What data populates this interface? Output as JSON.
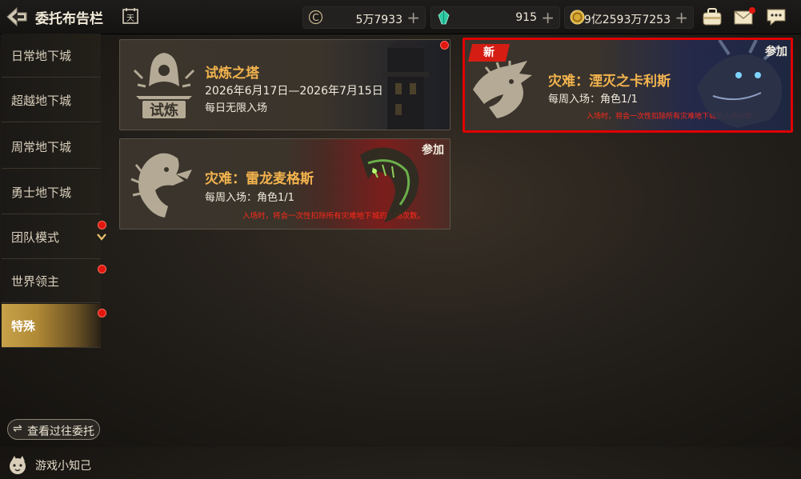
{
  "header": {
    "title": "委托布告栏",
    "calendar_icon_text": "天",
    "currencies": [
      {
        "name": "gold",
        "value": "5万7933"
      },
      {
        "name": "gem",
        "value": "915"
      },
      {
        "name": "coin",
        "value": "9亿2593万7253"
      }
    ],
    "plus_label": "+"
  },
  "sidebar": {
    "items": [
      {
        "label": "日常地下城",
        "badge": false
      },
      {
        "label": "超越地下城",
        "badge": false
      },
      {
        "label": "周常地下城",
        "badge": false
      },
      {
        "label": "勇士地下城",
        "badge": false
      },
      {
        "label": "团队模式",
        "badge": true
      },
      {
        "label": "世界领主",
        "badge": true
      },
      {
        "label": "特殊",
        "badge": true,
        "active": true
      }
    ],
    "history_button": "查看过往委托",
    "history_icon": "⇌",
    "tips_label": "游戏小知己"
  },
  "cards": [
    {
      "name": "试炼之塔",
      "emblem_text": "试炼",
      "date_range": "2026年6月17日—2026年7月15日",
      "entry": "每日无限入场",
      "has_dot": true
    },
    {
      "name": "灾难：雷龙麦格斯",
      "entry": "每周入场：角色1/1",
      "warning": "入场时，将会一次性扣除所有灾难地下城的入场次数。",
      "join": "参加"
    },
    {
      "name": "灾难：湮灭之卡利斯",
      "entry": "每周入场：角色1/1",
      "warning": "入场时，将会一次性扣除所有灾难地下城的入场次数。",
      "join": "参加",
      "badge": "新",
      "highlighted": true
    }
  ],
  "colors": {
    "accent_gold": "#f3b44e",
    "badge_red": "#e0160f",
    "highlight_border": "#e00000",
    "active_tab": "#c7a24a"
  },
  "icons": [
    "back-arrow-icon",
    "calendar-icon",
    "gold-currency-icon",
    "gem-currency-icon",
    "coin-currency-icon",
    "bag-icon",
    "mail-icon",
    "chat-icon",
    "chevron-down-icon",
    "swap-icon",
    "tips-mascot-icon",
    "tower-emblem-icon",
    "dragon-emblem-icon",
    "beast-emblem-icon"
  ]
}
